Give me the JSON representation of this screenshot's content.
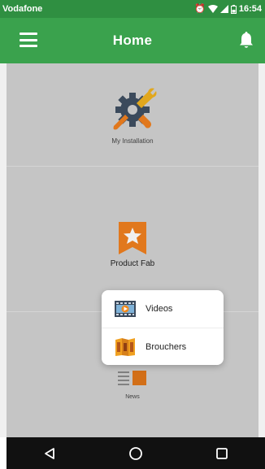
{
  "status_bar": {
    "carrier": "Vodafone",
    "time": "16:54",
    "icons": [
      "alarm-icon",
      "wifi-icon",
      "signal-icon",
      "battery-icon"
    ]
  },
  "app_bar": {
    "title": "Home",
    "menu_icon": "hamburger-menu-icon",
    "notification_icon": "bell-icon"
  },
  "tiles": [
    {
      "label": "My Installation",
      "icon": "tools-gear-icon"
    },
    {
      "label": "Product Fab",
      "icon": "star-bookmark-icon"
    },
    {
      "label": "News",
      "icon": "news-icon"
    }
  ],
  "popup_menu": {
    "items": [
      {
        "label": "Videos",
        "icon": "video-film-icon"
      },
      {
        "label": "Brouchers",
        "icon": "brochure-icon"
      }
    ]
  },
  "nav_bar": {
    "buttons": [
      "back-icon",
      "home-icon",
      "recents-icon"
    ]
  },
  "colors": {
    "status_bar": "#2f8f41",
    "app_bar": "#3aa24d",
    "accent_orange": "#f0801f",
    "background": "#d2d2d2"
  }
}
